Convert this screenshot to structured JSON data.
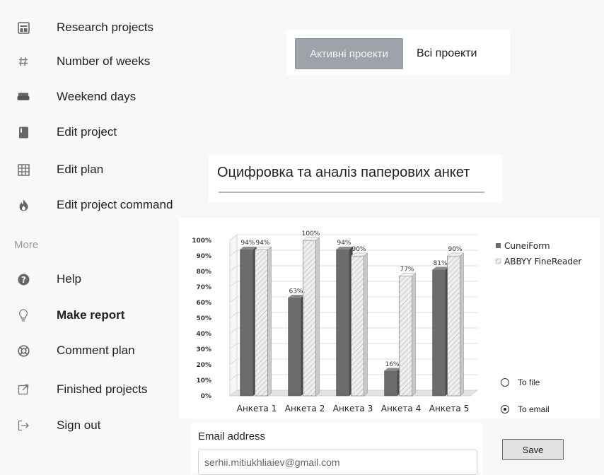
{
  "sidebar": {
    "items": [
      {
        "label": "Research projects",
        "icon": "table-icon"
      },
      {
        "label": "Number of weeks",
        "icon": "hash-icon"
      },
      {
        "label": "Weekend days",
        "icon": "sofa-icon"
      },
      {
        "label": "Edit project",
        "icon": "book-icon"
      },
      {
        "label": "Edit plan",
        "icon": "grid-icon"
      },
      {
        "label": "Edit project command",
        "icon": "fire-icon"
      }
    ],
    "more_label": "More",
    "more_items": [
      {
        "label": "Help",
        "icon": "question-icon"
      },
      {
        "label": "Make report",
        "icon": "lightbulb-icon"
      },
      {
        "label": "Comment plan",
        "icon": "lifebuoy-icon"
      },
      {
        "label": "Finished projects",
        "icon": "external-link-icon"
      },
      {
        "label": "Sign out",
        "icon": "sign-out-icon"
      }
    ]
  },
  "tabs": {
    "active": "Активні проекти",
    "all": "Всі проекти"
  },
  "panel_title": "Оцифровка та аналіз паперових анкет",
  "chart_data": {
    "type": "bar",
    "categories": [
      "Анкета 1",
      "Анкета 2",
      "Анкета 3",
      "Анкета 4",
      "Анкета 5"
    ],
    "series": [
      {
        "name": "CuneiForm",
        "values": [
          94,
          63,
          94,
          16,
          81
        ],
        "labels": [
          "94%",
          "63%",
          "94%",
          "16%",
          "81%"
        ],
        "color": "#6b6b6b"
      },
      {
        "name": "ABBYY FineReader",
        "values": [
          94,
          100,
          90,
          77,
          90
        ],
        "labels": [
          "94%",
          "100%",
          "90%",
          "77%",
          "90%"
        ],
        "color": "#e6e6e6"
      }
    ],
    "ylim": [
      0,
      100
    ],
    "y_ticks": [
      "0%",
      "10%",
      "20%",
      "30%",
      "40%",
      "50%",
      "60%",
      "70%",
      "80%",
      "90%",
      "100%"
    ],
    "grid": true,
    "legend": "right"
  },
  "export": {
    "options": [
      "To file",
      "To email"
    ],
    "selected": "To email",
    "email_label": "Email address",
    "email_value": "serhii.mitiukhliaiev@gmail.com",
    "save_label": "Save"
  }
}
